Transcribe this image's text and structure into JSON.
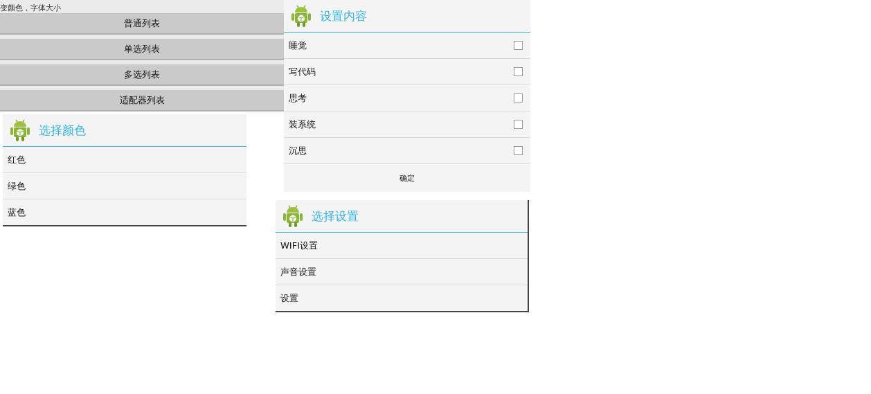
{
  "menu_panel": {
    "caption": "变颜色，字体大小",
    "buttons": [
      "普通列表",
      "单选列表",
      "多选列表",
      "适配器列表"
    ]
  },
  "dialogs": [
    {
      "title": "选择颜色",
      "kind": "plain",
      "items": [
        {
          "label": "红色"
        },
        {
          "label": "绿色"
        },
        {
          "label": "蓝色"
        }
      ]
    },
    {
      "title": "设置内容",
      "kind": "multi",
      "items": [
        {
          "label": "睡觉",
          "checked": false
        },
        {
          "label": "写代码",
          "checked": false
        },
        {
          "label": "思考",
          "checked": false
        },
        {
          "label": "装系统",
          "checked": false
        },
        {
          "label": "沉思",
          "checked": false
        }
      ],
      "confirm": "确定"
    },
    {
      "title": "选择设置",
      "kind": "plain",
      "items": [
        {
          "label": "WIFI设置"
        },
        {
          "label": "声音设置"
        },
        {
          "label": "设置"
        }
      ]
    }
  ]
}
